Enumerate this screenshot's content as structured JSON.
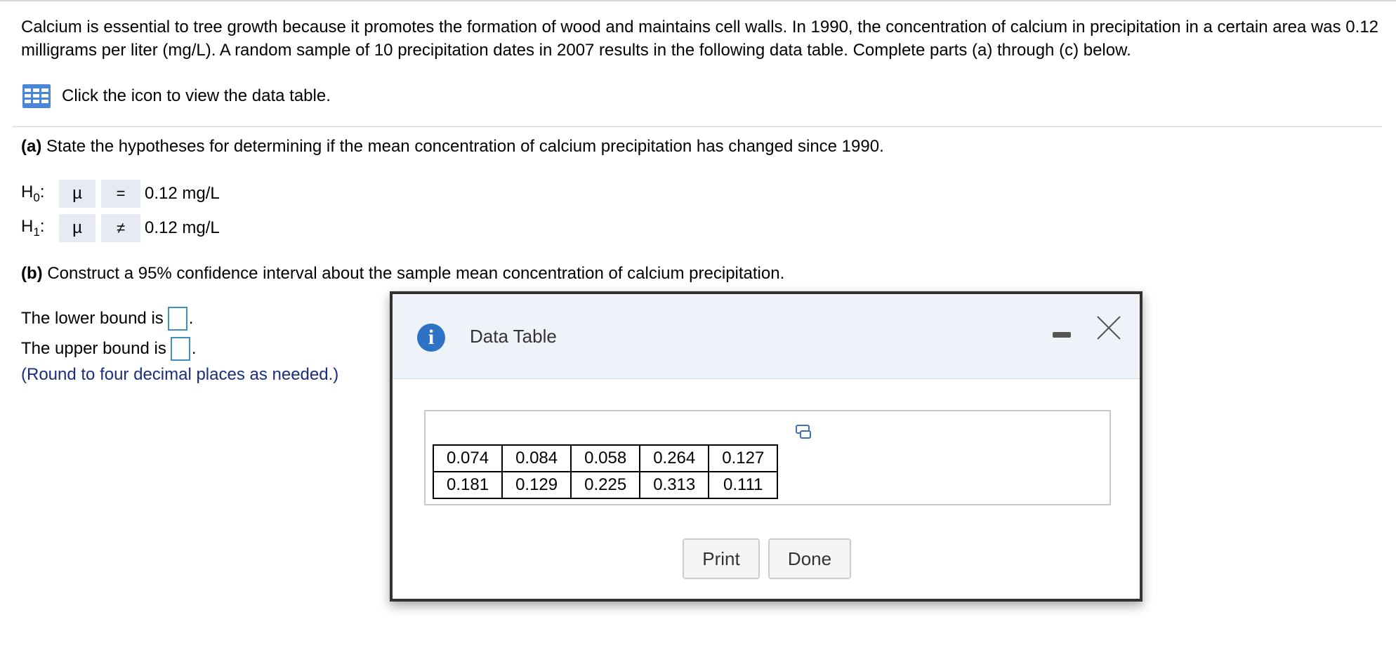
{
  "intro": {
    "text": "Calcium is essential to tree growth because it promotes the formation of wood and maintains cell walls. In 1990, the concentration of calcium in precipitation in a certain area was 0.12 milligrams per liter (mg/L). A random sample of 10 precipitation dates in 2007 results in the following data table. Complete parts (a) through (c) below."
  },
  "data_link": {
    "label": "Click the icon to view the data table."
  },
  "part_a": {
    "label": "(a)",
    "text": "State the hypotheses for determining if the mean concentration of calcium precipitation has changed since 1990.",
    "h0": {
      "label": "H",
      "sub": "0",
      "colon": ":",
      "param": "µ",
      "op": "=",
      "value": "0.12 mg/L"
    },
    "h1": {
      "label": "H",
      "sub": "1",
      "colon": ":",
      "param": "µ",
      "op": "≠",
      "value": "0.12 mg/L"
    }
  },
  "part_b": {
    "label": "(b)",
    "text": "Construct a 95% confidence interval about the sample mean concentration of calcium precipitation.",
    "lower_label": "The lower bound is",
    "upper_label": "The upper bound is",
    "lower_value": "",
    "upper_value": "",
    "period": ".",
    "round_note": "(Round to four decimal places as needed.)"
  },
  "dialog": {
    "title": "Data Table",
    "info_glyph": "i",
    "rows": [
      [
        "0.074",
        "0.084",
        "0.058",
        "0.264",
        "0.127"
      ],
      [
        "0.181",
        "0.129",
        "0.225",
        "0.313",
        "0.111"
      ]
    ],
    "print_label": "Print",
    "done_label": "Done"
  },
  "colors": {
    "accent_blue": "#2d72c4",
    "answer_box_border": "#3f8fbf",
    "note_text": "#1b2d80",
    "hypothesis_cell_bg": "#e6eaf2",
    "dialog_header_bg": "#eef3f9"
  }
}
